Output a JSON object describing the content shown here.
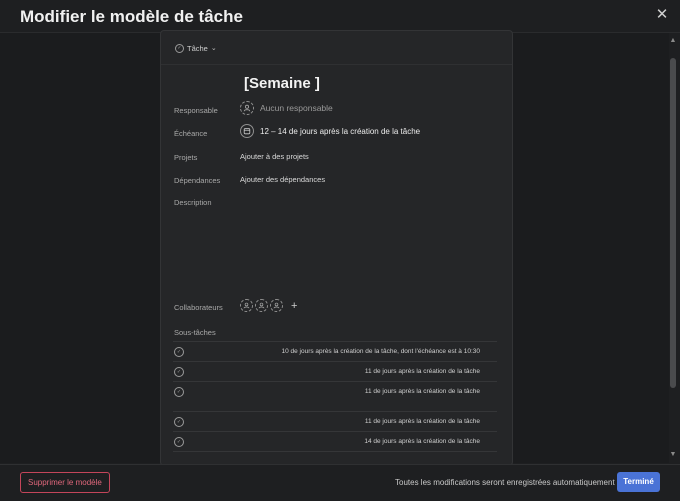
{
  "modal": {
    "title": "Modifier le modèle de tâche",
    "close_icon": "close-icon"
  },
  "type_chip": {
    "label": "Tâche",
    "icon": "check-circle-icon",
    "chevron": "chevron-down-icon"
  },
  "task": {
    "title": "[Semaine ]"
  },
  "fields": {
    "responsable": {
      "label": "Responsable",
      "value": "Aucun responsable",
      "icon": "user-icon"
    },
    "echeance": {
      "label": "Échéance",
      "value": "12 – 14 de jours après la création de la tâche",
      "icon": "calendar-icon"
    },
    "projets": {
      "label": "Projets",
      "value": "Ajouter à des projets"
    },
    "dependances": {
      "label": "Dépendances",
      "value": "Ajouter des dépendances"
    },
    "description": {
      "label": "Description",
      "value": ""
    },
    "collaborateurs": {
      "label": "Collaborateurs",
      "add_icon": "plus-icon"
    }
  },
  "subtasks": {
    "label": "Sous-tâches",
    "items": [
      {
        "text": "10 de jours après la création de la tâche, dont l'échéance est à 10:30"
      },
      {
        "text": "11 de jours après la création de la tâche"
      },
      {
        "text": "11 de jours après la création de la tâche"
      },
      {
        "text": ""
      },
      {
        "text": "11 de jours après la création de la tâche"
      },
      {
        "text": "14 de jours après la création de la tâche"
      }
    ]
  },
  "footer": {
    "delete_label": "Supprimer le modèle",
    "autosave_text": "Toutes les modifications seront enregistrées automatiquement",
    "done_label": "Terminé"
  },
  "colors": {
    "accent": "#4a73d6",
    "danger": "#c4455a",
    "background": "#1e1f21",
    "panel": "#252628"
  }
}
